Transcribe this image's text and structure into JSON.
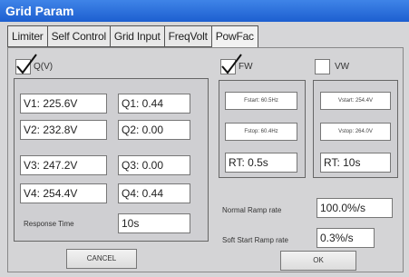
{
  "window": {
    "title": "Grid Param"
  },
  "tabs": [
    "Limiter",
    "Self Control",
    "Grid Input",
    "FreqVolt",
    "PowFac"
  ],
  "qv": {
    "label": "Q(V)",
    "checked": true,
    "v": [
      "V1: 225.6V",
      "V2: 232.8V",
      "V3: 247.2V",
      "V4: 254.4V"
    ],
    "q": [
      "Q1: 0.44",
      "Q2: 0.00",
      "Q3: 0.00",
      "Q4: 0.44"
    ],
    "response_time_label": "Response Time",
    "response_time_value": "10s"
  },
  "fw": {
    "label": "FW",
    "checked": true,
    "fstart": "Fstart: 60.5Hz",
    "fstop": "Fstop: 60.4Hz",
    "rt": "RT: 0.5s"
  },
  "vw": {
    "label": "VW",
    "checked": false,
    "vstart": "Vstart: 254.4V",
    "vstop": "Vstop: 264.0V",
    "rt": "RT: 10s"
  },
  "ramp": {
    "normal_label": "Normal Ramp rate",
    "normal_value": "100.0%/s",
    "softstart_label": "Soft Start Ramp rate",
    "softstart_value": "0.3%/s"
  },
  "buttons": {
    "cancel": "CANCEL",
    "ok": "OK"
  }
}
